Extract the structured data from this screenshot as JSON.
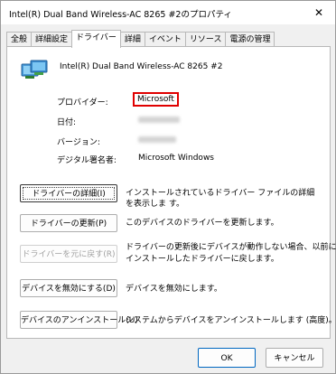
{
  "window": {
    "title": "Intel(R) Dual Band Wireless-AC 8265 #2のプロパティ",
    "close_glyph": "✕"
  },
  "tabs": [
    {
      "label": "全般"
    },
    {
      "label": "詳細設定"
    },
    {
      "label": "ドライバー",
      "active": true
    },
    {
      "label": "詳細"
    },
    {
      "label": "イベント"
    },
    {
      "label": "リソース"
    },
    {
      "label": "電源の管理"
    }
  ],
  "device": {
    "icon": "network-adapter-icon",
    "name": "Intel(R) Dual Band Wireless-AC 8265 #2"
  },
  "properties": {
    "provider_label": "プロバイダー:",
    "provider_value": "Microsoft",
    "date_label": "日付:",
    "version_label": "バージョン:",
    "signer_label": "デジタル署名者:",
    "signer_value": "Microsoft Windows"
  },
  "actions": {
    "details_button": "ドライバーの詳細(I)",
    "details_desc": "インストールされているドライバー ファイルの詳細を表示しま す。",
    "update_button": "ドライバーの更新(P)",
    "update_desc": "このデバイスのドライバーを更新します。",
    "rollback_button": "ドライバーを元に戻す(R)",
    "rollback_desc_line1": "ドライバーの更新後にデバイスが動作しない場合、以前に",
    "rollback_desc_line2": "インストールしたドライバーに戻します。",
    "disable_button": "デバイスを無効にする(D)",
    "disable_desc": "デバイスを無効にします。",
    "uninstall_button": "デバイスのアンインストール(U)",
    "uninstall_desc": "システムからデバイスをアンインストールします (高度)。"
  },
  "footer": {
    "ok_button": "OK",
    "cancel_button": "キャンセル"
  },
  "colors": {
    "highlight_border": "#e00000",
    "accent": "#0067c0"
  }
}
